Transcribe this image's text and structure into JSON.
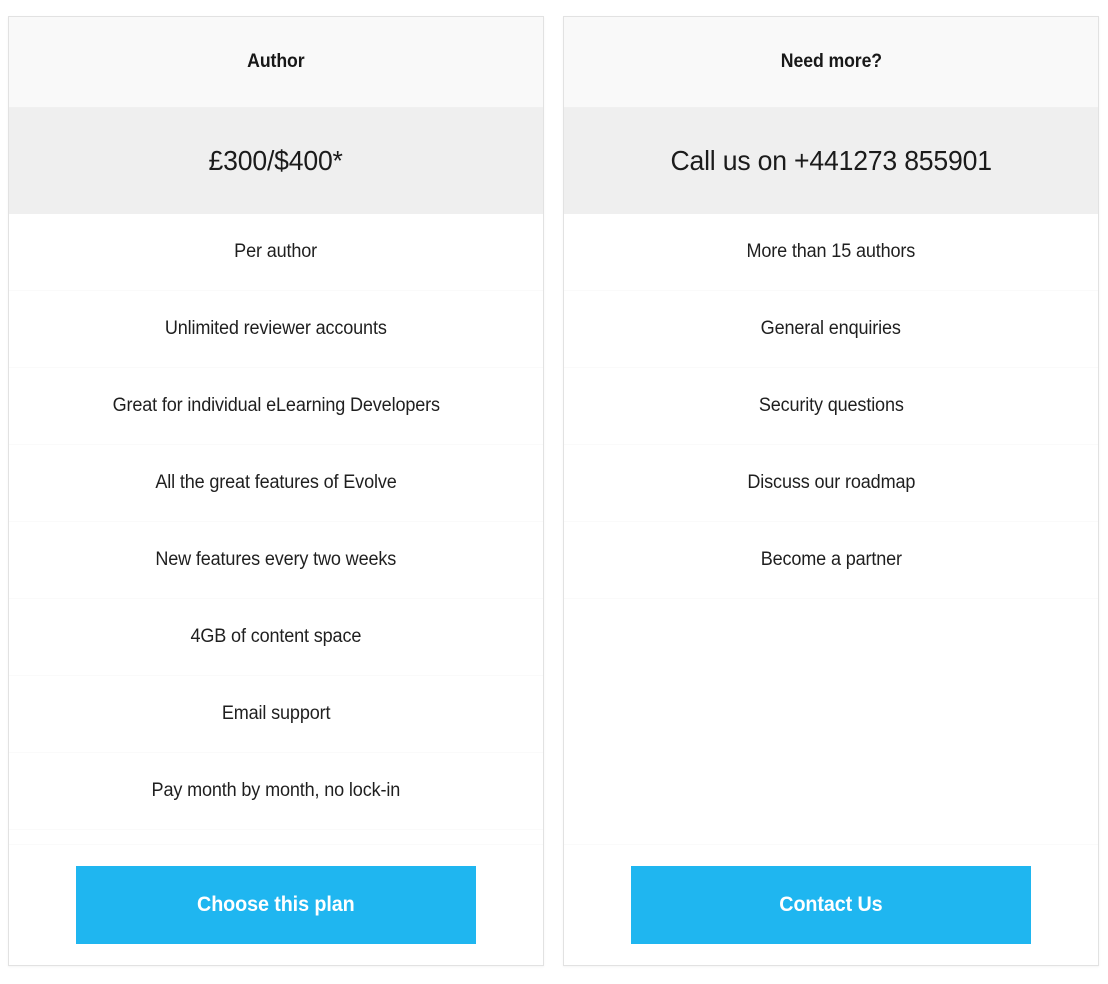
{
  "theme": {
    "accent_color": "#1fb6f0",
    "card_border_color": "#e2e2e2",
    "header_bg": "#f9f9f9",
    "price_bg": "#efefef",
    "divider_color": "#fafafa",
    "text_color": "#1f1f1f"
  },
  "plans": [
    {
      "id": "author",
      "title": "Author",
      "price": "£300/$400*",
      "features": [
        "Per author",
        "Unlimited reviewer accounts",
        "Great for individual eLearning Developers",
        "All the great features of Evolve",
        "New features every two weeks",
        "4GB of content space",
        "Email support",
        "Pay month by month, no lock-in"
      ],
      "cta_label": "Choose this plan"
    },
    {
      "id": "need-more",
      "title": "Need more?",
      "price": "Call us on +441273 855901",
      "features": [
        "More than 15 authors",
        "General enquiries",
        "Security questions",
        "Discuss our roadmap",
        "Become a partner"
      ],
      "cta_label": "Contact Us"
    }
  ]
}
